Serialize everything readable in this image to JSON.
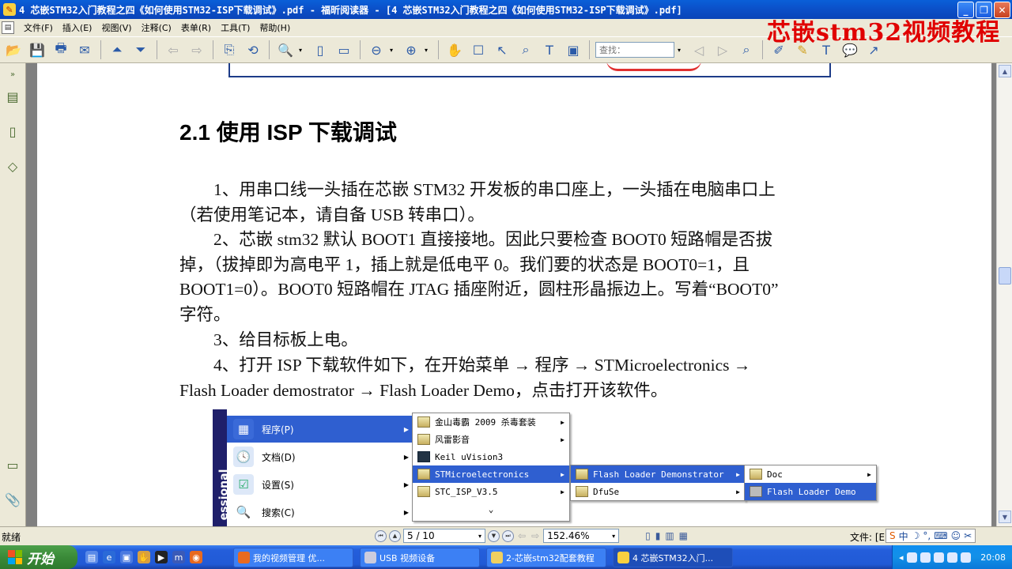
{
  "window": {
    "title": "4 芯嵌STM32入门教程之四《如何使用STM32-ISP下载调试》.pdf - 福昕阅读器 - [4 芯嵌STM32入门教程之四《如何使用STM32-ISP下载调试》.pdf]",
    "watermark": "芯嵌stm32视频教程"
  },
  "menu": [
    "文件(F)",
    "插入(E)",
    "视图(V)",
    "注释(C)",
    "表单(R)",
    "工具(T)",
    "帮助(H)"
  ],
  "toolbar": {
    "search_placeholder": "查找："
  },
  "document": {
    "heading": "2.1 使用 ISP 下载调试",
    "lines": [
      "　　1、用串口线一头插在芯嵌 STM32 开发板的串口座上，一头插在电脑串口上",
      "（若使用笔记本，请自备 USB 转串口）。",
      "　　2、芯嵌 stm32 默认 BOOT1 直接接地。因此只要检查 BOOT0 短路帽是否拔",
      "掉，（拔掉即为高电平 1，插上就是低电平 0。我们要的状态是 BOOT0=1，且",
      "BOOT1=0）。BOOT0 短路帽在 JTAG 插座附近，圆柱形晶振边上。写着“BOOT0”",
      "字符。",
      "　　3、给目标板上电。",
      "　　4、打开 ISP 下载软件如下，在开始菜单 → 程序 → STMicroelectronics →",
      "Flash Loader demostrator → Flash Loader Demo，点击打开该软件。"
    ],
    "startmenu": {
      "strip_text": "essional",
      "main_items": [
        "程序(P)",
        "文档(D)",
        "设置(S)",
        "搜索(C)"
      ],
      "programs": [
        "金山毒霸 2009 杀毒套装",
        "风雷影音",
        "Keil uVision3",
        "STMicroelectronics",
        "STC_ISP_V3.5",
        "⌄"
      ],
      "st_sub": [
        "Flash Loader Demonstrator",
        "DfuSe"
      ],
      "fld_sub": [
        "Doc",
        "Flash Loader Demo"
      ]
    }
  },
  "statusbar": {
    "ready": "就绪",
    "page": "5 / 10",
    "zoom": "152.46%",
    "file_label": "文件: [E"
  },
  "taskbar": {
    "start": "开始",
    "tasks": [
      "我的视频管理 优...",
      "USB 视频设备",
      "2-芯嵌stm32配套教程",
      "4 芯嵌STM32入门..."
    ],
    "clock": "20:08"
  }
}
